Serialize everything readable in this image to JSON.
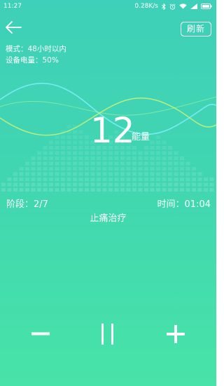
{
  "status_bar": {
    "time": "11:27",
    "network_speed": "0.28K/s",
    "icons": [
      "bluetooth-icon",
      "alarm-icon",
      "wifi-icon",
      "signal-icon",
      "battery-icon"
    ]
  },
  "header": {
    "back_icon": "back-arrow-icon",
    "refresh_label": "刷新"
  },
  "device_info": {
    "mode_text": "模式：48小时以内",
    "battery_text": "设备电量：50%"
  },
  "energy": {
    "value": "12",
    "unit": "能量"
  },
  "session": {
    "stage_text": "阶段：2/7",
    "time_text": "时间：01:04",
    "treatment_name": "止痛治疗"
  },
  "controls": {
    "decrease_icon": "minus-icon",
    "pause_icon": "pause-icon",
    "increase_icon": "plus-icon"
  },
  "colors": {
    "background_top": "#3fd0b9",
    "background_bottom": "#48e3a8",
    "foreground": "#ffffff",
    "wave_cyan": "#7ff0ff",
    "wave_green": "#c8f27a"
  }
}
